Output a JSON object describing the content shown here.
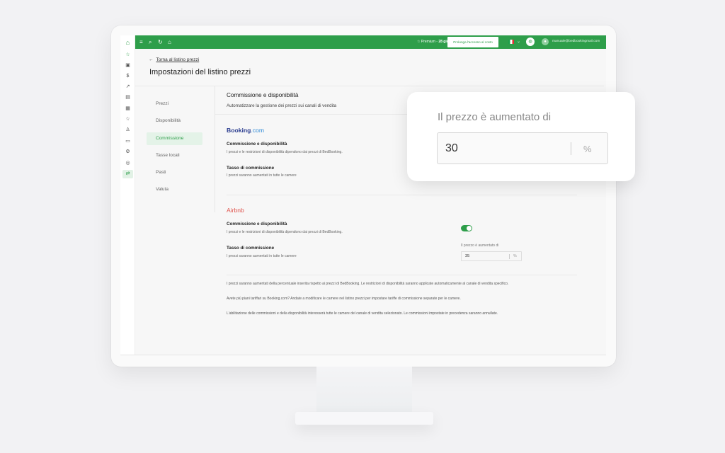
{
  "topbar": {
    "premium_prefix": "Premium - ",
    "premium_days": "28 giorni",
    "extend_label": "Prolunga l'accesso al costo",
    "username": "manuale@bedbookingmail.com"
  },
  "page": {
    "back_label": "Torna al listino prezzi",
    "title": "Impostazioni del listino prezzi"
  },
  "menu": {
    "items": [
      {
        "label": "Prezzi"
      },
      {
        "label": "Disponibilità"
      },
      {
        "label": "Commissione"
      },
      {
        "label": "Tasse locali"
      },
      {
        "label": "Pasti"
      },
      {
        "label": "Valuta"
      }
    ],
    "active_index": 2
  },
  "section": {
    "title": "Commissione e disponibilità",
    "subtitle": "Automatizzare la gestione dei prezzi sui canali di vendita"
  },
  "booking": {
    "name": "Booking",
    "suffix": ".com",
    "rows": [
      {
        "title": "Commissione e disponibilità",
        "desc": "I prezzi e le restrizioni di disponibilità dipendono dai prezzi di BedBooking."
      },
      {
        "title": "Tasso di commissione",
        "desc": "I prezzi saranno aumentati in tutte le camere"
      }
    ]
  },
  "airbnb": {
    "name": "Airbnb",
    "rows": [
      {
        "title": "Commissione e disponibilità",
        "desc": "I prezzi e le restrizioni di disponibilità dipendono dai prezzi di BedBooking."
      },
      {
        "title": "Tasso di commissione",
        "desc": "I prezzi saranno aumentati in tutte le camere"
      }
    ],
    "toggle_on": true,
    "rate_label": "Il prezzo è aumentato di",
    "rate_value": "35",
    "rate_unit": "%"
  },
  "notes": [
    "I prezzi saranno aumentati della percentuale inserita rispetto ai prezzi di BedBooking. Le restrizioni di disponibilità saranno applicate automaticamente al canale di vendita specifico.",
    "Avete più piani tariffari su Booking.com? Andate a modificare le camere nel listino prezzi per impostare tariffe di commissione separate per le camere.",
    "L'abilitazione delle commissioni e della disponibilità interesserà tutte le camere del canale di vendita selezionato. Le commissioni impostate in precedenza saranno annullate."
  ],
  "zoom": {
    "label": "Il prezzo è aumentato di",
    "value": "30",
    "unit": "%"
  },
  "colors": {
    "brand": "#2e9e4a",
    "booking": "#2b3d8f",
    "airbnb": "#e0544e"
  }
}
